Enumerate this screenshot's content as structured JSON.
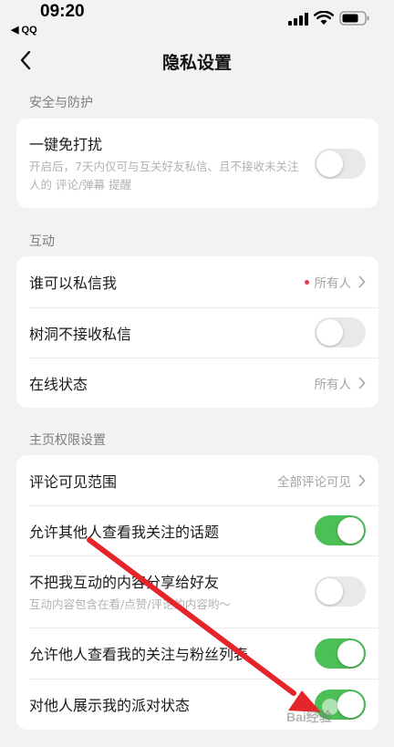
{
  "status_bar": {
    "time": "09:20",
    "back_app": "◀ QQ"
  },
  "nav": {
    "title": "隐私设置"
  },
  "sections": {
    "security": {
      "header": "安全与防护",
      "dnd_title": "一键免打扰",
      "dnd_desc": "开启后，7天内仅可与互关好友私信、且不接收未关注人的 评论/弹幕 提醒",
      "dnd_on": false
    },
    "interaction": {
      "header": "互动",
      "dm_title": "谁可以私信我",
      "dm_value": "所有人",
      "treehole_title": "树洞不接收私信",
      "treehole_on": false,
      "online_title": "在线状态",
      "online_value": "所有人"
    },
    "homepage": {
      "header": "主页权限设置",
      "comment_title": "评论可见范围",
      "comment_value": "全部评论可见",
      "topics_title": "允许其他人查看我关注的话题",
      "topics_on": true,
      "share_title": "不把我互动的内容分享给好友",
      "share_desc": "互动内容包含在看/点赞/评论的内容哟～",
      "share_on": false,
      "follow_title": "允许他人查看我的关注与粉丝列表",
      "follow_on": true,
      "party_title": "对他人展示我的派对状态",
      "party_on": true
    }
  },
  "colors": {
    "toggle_on": "#4cbf57",
    "toggle_off": "#e9e9eb",
    "red_dot": "#e8384d",
    "arrow": "#e4262b"
  },
  "watermark": "Bai经验"
}
